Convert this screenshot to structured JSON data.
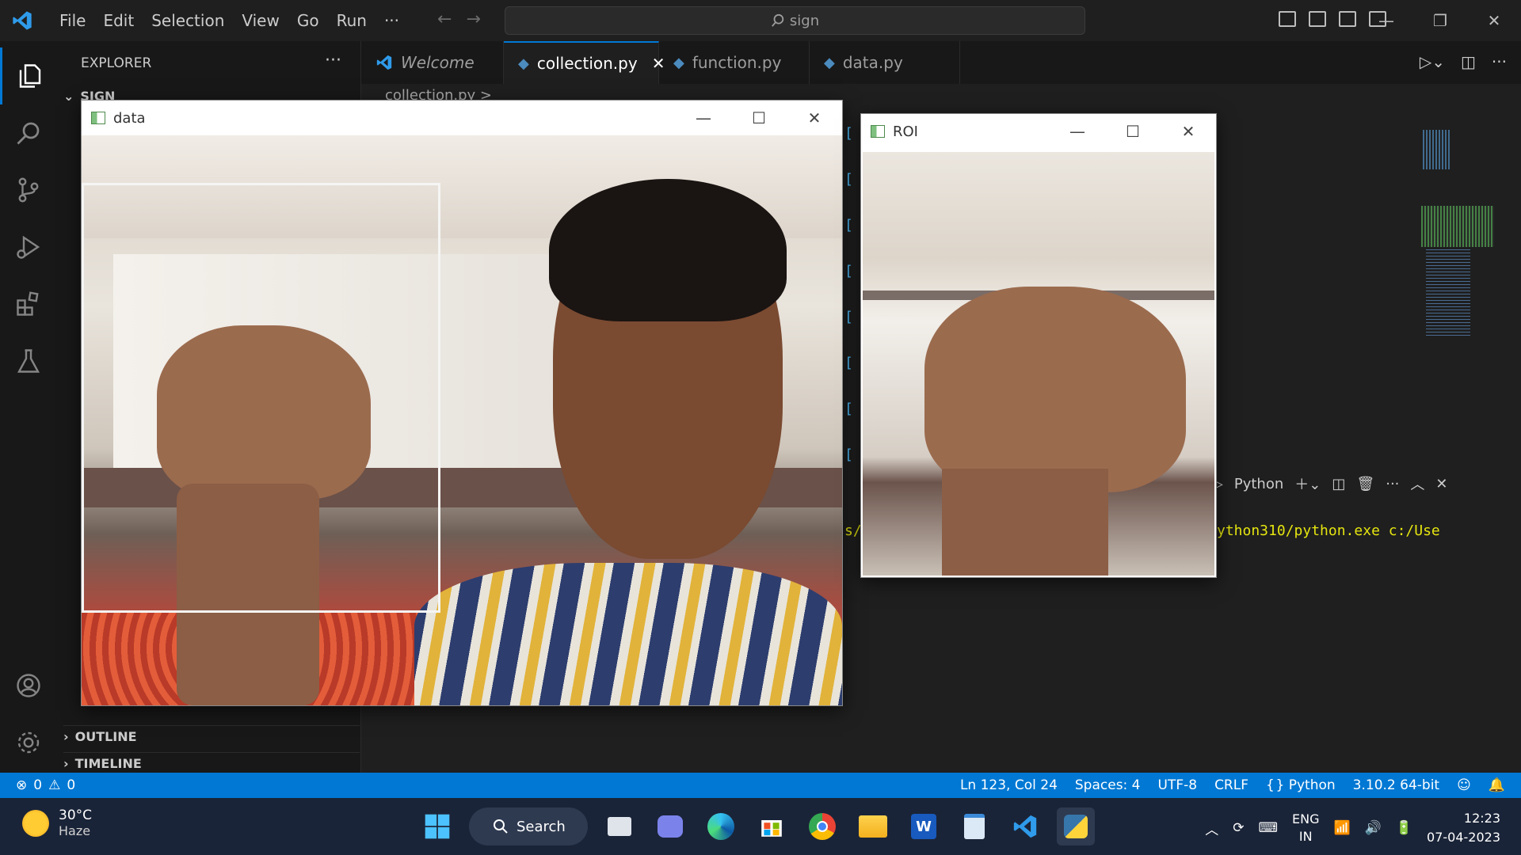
{
  "menu": [
    "File",
    "Edit",
    "Selection",
    "View",
    "Go",
    "Run",
    "···"
  ],
  "search": {
    "text": "sign"
  },
  "sidebar": {
    "title": "EXPLORER",
    "folder": "SIGN",
    "outline": "OUTLINE",
    "timeline": "TIMELINE"
  },
  "tabs": [
    {
      "label": "Welcome"
    },
    {
      "label": "collection.py"
    },
    {
      "label": "function.py"
    },
    {
      "label": "data.py"
    }
  ],
  "breadcrumb": "collection.py >",
  "terminal": {
    "shell_label": "Python",
    "line": "ython310/python.exe c:/Use",
    "prefix": "s/"
  },
  "cv_windows": {
    "data_title": "data",
    "roi_title": "ROI"
  },
  "status": {
    "errors": "0",
    "warnings": "0",
    "position": "Ln 123, Col 24",
    "spaces": "Spaces: 4",
    "encoding": "UTF-8",
    "eol": "CRLF",
    "language": "Python",
    "interpreter": "3.10.2 64-bit"
  },
  "taskbar": {
    "temp": "30°C",
    "weather": "Haze",
    "search_label": "Search",
    "lang1": "ENG",
    "lang2": "IN",
    "time": "12:23",
    "date": "07-04-2023"
  },
  "colors": {
    "accent": "#0078d4",
    "status_bar": "#0078d4",
    "terminal_yellow": "#e5e510"
  }
}
